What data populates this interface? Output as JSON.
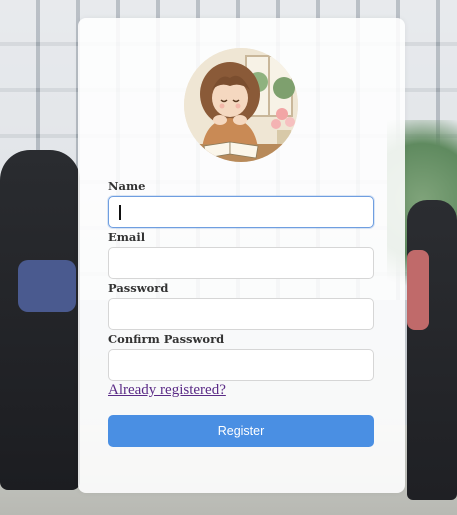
{
  "form": {
    "name_label": "Name",
    "name_value": "",
    "email_label": "Email",
    "email_value": "",
    "password_label": "Password",
    "password_value": "",
    "confirm_password_label": "Confirm Password",
    "confirm_password_value": "",
    "login_link": "Already registered?",
    "register_button": "Register"
  },
  "theme": {
    "accent": "#4a8fe3",
    "focus_border": "#6f9ee0",
    "link_color": "#5a2a86"
  },
  "icons": {
    "avatar": "girl-reading-illustration"
  }
}
